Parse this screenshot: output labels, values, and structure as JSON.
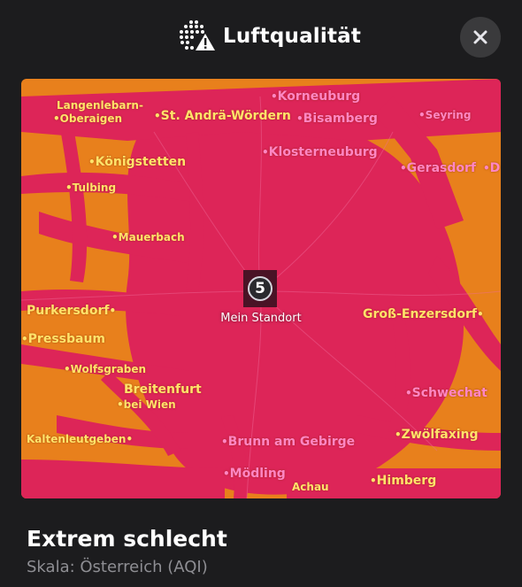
{
  "header": {
    "title": "Luftqualität",
    "title_icon": "air-quality-warning-icon",
    "close_icon": "close-icon"
  },
  "colors": {
    "background": "#1c1c1e",
    "map_base": "#e8801c",
    "pollution_overlay": "#dd2558",
    "label_yellow": "#ffe36a",
    "label_pink": "#ff86c4"
  },
  "map": {
    "places": [
      {
        "name": "Langenlebarn-",
        "color": "yellow"
      },
      {
        "name": "Oberaigen",
        "color": "yellow"
      },
      {
        "name": "St. Andrä-Wördern",
        "color": "yellow"
      },
      {
        "name": "Korneuburg",
        "color": "pink"
      },
      {
        "name": "Bisamberg",
        "color": "pink"
      },
      {
        "name": "Seyring",
        "color": "pink"
      },
      {
        "name": "Königstetten",
        "color": "yellow"
      },
      {
        "name": "Klosterneuburg",
        "color": "pink"
      },
      {
        "name": "Gerasdorf",
        "color": "pink"
      },
      {
        "name": "D",
        "color": "pink"
      },
      {
        "name": "Tulbing",
        "color": "yellow"
      },
      {
        "name": "Mauerbach",
        "color": "yellow"
      },
      {
        "name": "Purkersdorf",
        "color": "yellow"
      },
      {
        "name": "Groß-Enzersdorf",
        "color": "yellow"
      },
      {
        "name": "Pressbaum",
        "color": "yellow"
      },
      {
        "name": "Wolfsgraben",
        "color": "yellow"
      },
      {
        "name": "Breitenfurt",
        "color": "yellow"
      },
      {
        "name": "bei Wien",
        "color": "yellow"
      },
      {
        "name": "Schwechat",
        "color": "pink"
      },
      {
        "name": "Kaltenleutgeben",
        "color": "yellow"
      },
      {
        "name": "Brunn am Gebirge",
        "color": "pink"
      },
      {
        "name": "Zwölfaxing",
        "color": "yellow"
      },
      {
        "name": "Mödling",
        "color": "pink"
      },
      {
        "name": "Achau",
        "color": "yellow"
      },
      {
        "name": "Himberg",
        "color": "yellow"
      }
    ],
    "marker": {
      "aqi_value": "5",
      "label": "Mein Standort"
    }
  },
  "status": {
    "level": "Extrem schlecht",
    "scale": "Skala: Österreich (AQI)"
  }
}
